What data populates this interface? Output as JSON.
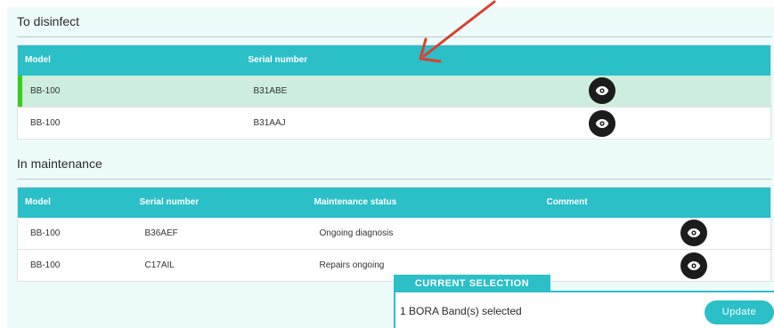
{
  "disinfect": {
    "title": "To disinfect",
    "headers": [
      "Model",
      "Serial number"
    ],
    "rows": [
      {
        "model": "BB-100",
        "serial": "B31ABE",
        "selected": true
      },
      {
        "model": "BB-100",
        "serial": "B31AAJ",
        "selected": false
      }
    ]
  },
  "maintenance": {
    "title": "In maintenance",
    "headers": [
      "Model",
      "Serial number",
      "Maintenance status",
      "Comment"
    ],
    "rows": [
      {
        "model": "BB-100",
        "serial": "B36AEF",
        "status": "Ongoing diagnosis",
        "comment": ""
      },
      {
        "model": "BB-100",
        "serial": "C17AIL",
        "status": "Repairs ongoing",
        "comment": ""
      }
    ]
  },
  "selection": {
    "tab_label": "CURRENT SELECTION",
    "summary": "1 BORA Band(s) selected",
    "update_label": "Update"
  },
  "icons": {
    "view": "eye-icon",
    "annotation": "red-arrow"
  },
  "colors": {
    "accent": "#2bbfc8",
    "selected_row": "#cdeede",
    "selected_marker": "#33d11a",
    "annotation": "#d9412f"
  }
}
